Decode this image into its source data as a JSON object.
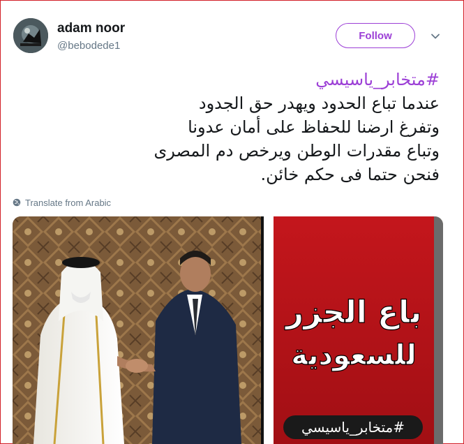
{
  "user": {
    "display_name": "adam noor",
    "username": "@bebodede1"
  },
  "actions": {
    "follow_label": "Follow",
    "menu_icon": "chevron-down-icon"
  },
  "tweet": {
    "hashtag": "#متخابر_ياسيسي",
    "lines": [
      "عندما تباع الحدود ويهدر حق الجدود",
      "وتفرغ ارضنا للحفاظ على أمان عدونا",
      "وتباع مقدرات الوطن ويرخص دم المصرى",
      "فنحن حتما فى حكم خائن."
    ],
    "translate_label": "Translate from Arabic",
    "translate_icon": "globe-icon"
  },
  "media": {
    "headline_line1": "باع الجزر",
    "headline_line2": "للسعودية",
    "hashtag_badge": "#متخابر_ياسيسي"
  },
  "colors": {
    "accent": "#9c3fd6",
    "frame": "#d21f27",
    "banner_red": "#c4161c",
    "text": "#14171a",
    "muted": "#657786"
  }
}
